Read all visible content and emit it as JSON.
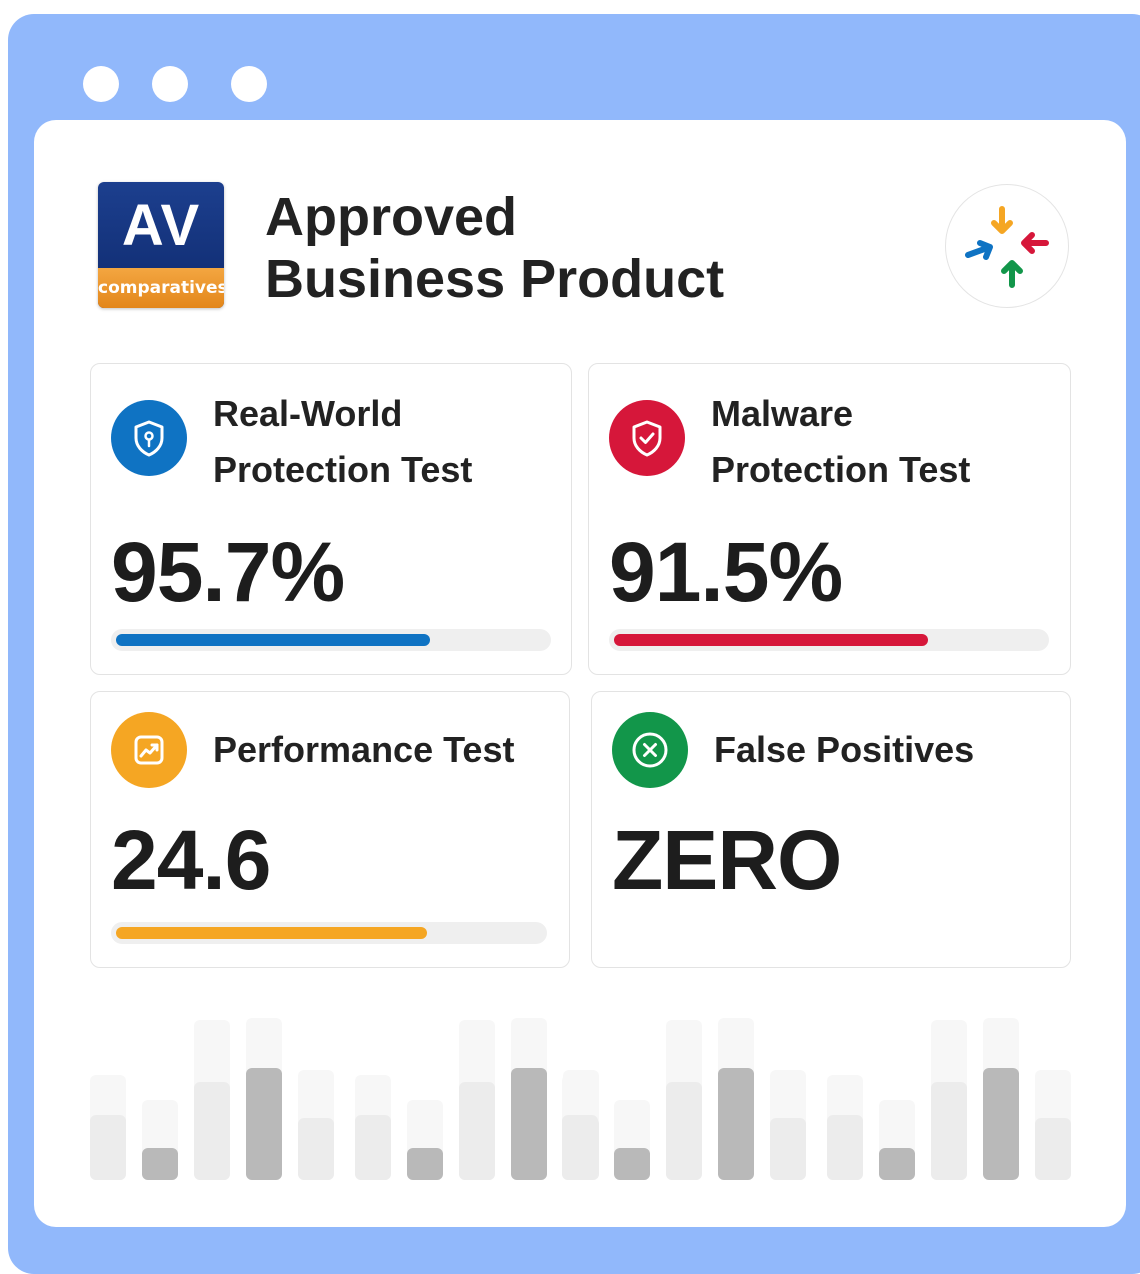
{
  "window": {
    "controls": [
      "dot",
      "dot",
      "dot"
    ]
  },
  "header": {
    "logo": {
      "main_text": "AV",
      "band_text": "comparatives"
    },
    "title_line1": "Approved",
    "title_line2": "Business Product",
    "brand_icon": "arrows-converge-icon"
  },
  "cards": [
    {
      "label_line1": "Real-World",
      "label_line2": "Protection Test",
      "value": "95.7%",
      "progress": 0.73,
      "color": "#0f73c3",
      "icon": "shield-keyhole-icon"
    },
    {
      "label_line1": "Malware",
      "label_line2": "Protection Test",
      "value": "91.5%",
      "progress": 0.73,
      "color": "#d6173a",
      "icon": "shield-check-icon"
    },
    {
      "label_line1": "Performance Test",
      "value": "24.6",
      "progress": 0.73,
      "color": "#f5a623",
      "icon": "trend-up-icon"
    },
    {
      "label_line1": "False Positives",
      "value": "ZERO",
      "color": "#12964a",
      "icon": "circle-x-icon"
    }
  ],
  "decorative_bars": {
    "colors": {
      "light": "#f7f7f7",
      "mid": "#ececec",
      "dark": "#b9b9b9"
    }
  }
}
